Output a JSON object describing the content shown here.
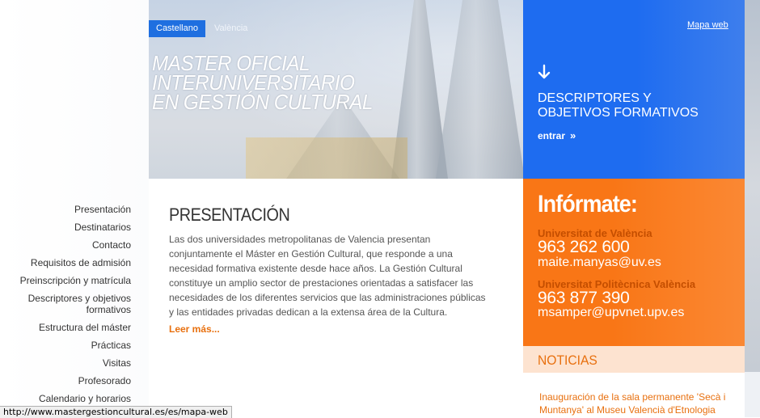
{
  "language": {
    "options": [
      "Castellano",
      "València"
    ],
    "selected": "Castellano"
  },
  "header": {
    "title_lines": [
      "MASTER OFICIAL",
      "INTERUNIVERSITARIO",
      "EN GESTIÓN CULTURAL"
    ],
    "sitemap_link": "Mapa web"
  },
  "promo": {
    "icon": "arrow-down-icon",
    "title": "DESCRIPTORES Y OBJETIVOS FORMATIVOS",
    "link": "entrar",
    "link_icon": "»",
    "color": "#1e6cf0"
  },
  "sidebar": {
    "items": [
      {
        "label": "Presentación"
      },
      {
        "label": "Destinatarios"
      },
      {
        "label": "Contacto"
      },
      {
        "label": "Requisitos de admisión"
      },
      {
        "label": "Preinscripción y matrícula"
      },
      {
        "label": "Descriptores y objetivos formativos"
      },
      {
        "label": "Estructura del máster"
      },
      {
        "label": "Prácticas"
      },
      {
        "label": "Visitas"
      },
      {
        "label": "Profesorado"
      },
      {
        "label": "Calendario y horarios"
      }
    ]
  },
  "main": {
    "heading": "PRESENTACIÓN",
    "paragraph": "Las dos universidades metropolitanas de Valencia presentan conjuntamente el Máster en Gestión Cultural, que responde a una necesidad formativa existente desde hace años. La Gestión Cultural constituye un amplio sector de prestaciones orientadas a satisfacer las necesidades de los diferentes servicios que las administraciones públicas y las entidades privadas dedican a la extensa área de la Cultura.",
    "read_more": "Leer más..."
  },
  "info": {
    "title": "Infórmate:",
    "color": "#f97616",
    "contacts": [
      {
        "university": "Universitat de València",
        "phone": "963 262 600",
        "email": "maite.manyas@uv.es"
      },
      {
        "university": "Universitat Politècnica València",
        "phone": "963 877 390",
        "email": "msamper@upvnet.upv.es"
      }
    ]
  },
  "news": {
    "heading": "NOTICIAS",
    "items": [
      "Inauguración de la sala permanente 'Secà i Muntanya' al Museu Valencià d'Etnologia"
    ]
  },
  "status_bar": {
    "url": "http://www.mastergestioncultural.es/es/mapa-web"
  }
}
